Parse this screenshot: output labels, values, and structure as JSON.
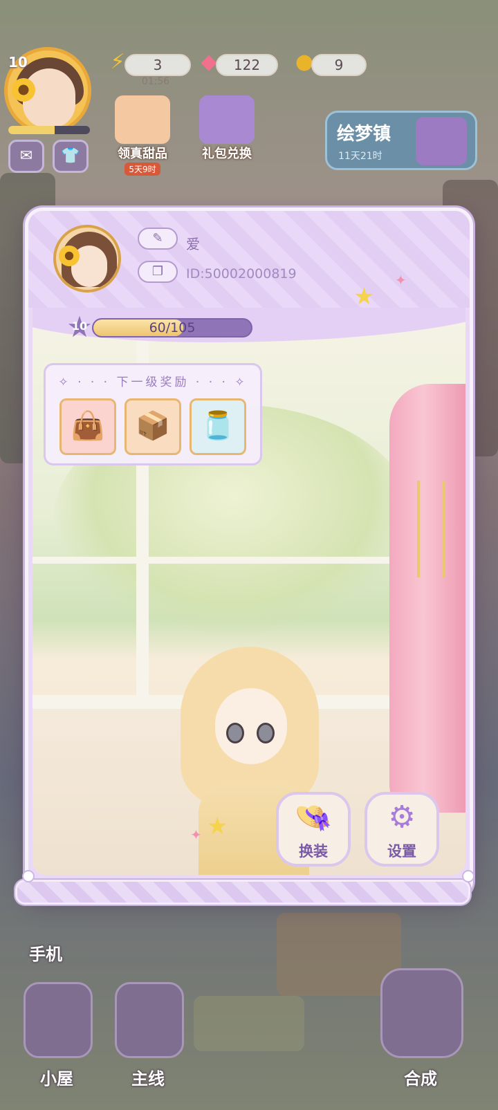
{
  "hud": {
    "player_level": "10",
    "energy": "3",
    "energy_timer": "01:56",
    "gems": "122",
    "coins": "9",
    "event_dessert": {
      "label": "领真甜品",
      "sub": "5天9时"
    },
    "event_gift": {
      "label": "礼包兑换"
    },
    "town": {
      "title": "绘梦镇",
      "timer": "11天21时"
    }
  },
  "bottom_nav": {
    "phone": "手机",
    "house": "小屋",
    "main_quest": "主线",
    "merge": "合成"
  },
  "profile": {
    "username": "爱",
    "user_id": "ID:50002000819",
    "level": "10",
    "xp_text": "60/105",
    "xp_progress": 0.571,
    "next_reward_title": "下一级奖励",
    "rewards": [
      "shopping-bag-icon",
      "treasure-chest-icon",
      "water-dispenser-icon"
    ]
  },
  "actions": {
    "dress_up": "换装",
    "settings": "设置"
  }
}
